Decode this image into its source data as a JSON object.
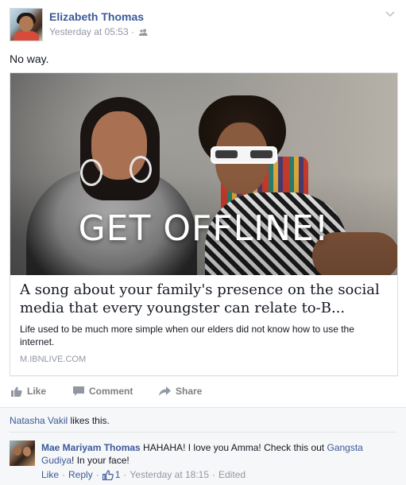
{
  "post": {
    "author": "Elizabeth Thomas",
    "timestamp": "Yesterday at 05:53",
    "audience_icon": "friends-icon",
    "message": "No way."
  },
  "share": {
    "image_caption": "GET OFFLINE!",
    "title": "A song about your family's presence on the social media that every youngster can relate to-B...",
    "description": "Life used to be much more simple when our elders did not know how to use the internet.",
    "domain": "M.IBNLIVE.COM"
  },
  "actions": {
    "like": "Like",
    "comment": "Comment",
    "share": "Share"
  },
  "likes": {
    "name": "Natasha Vakil",
    "suffix": " likes this."
  },
  "comment": {
    "author": "Mae Mariyam Thomas",
    "text_before": " HAHAHA! I love you Amma! Check this out ",
    "link": "Gangsta Gudiya",
    "text_after": "! In your face!",
    "like": "Like",
    "reply": "Reply",
    "like_count": "1",
    "timestamp": "Yesterday at 18:15",
    "edited": "Edited"
  },
  "colors": {
    "link": "#3b5998",
    "meta": "#9197a3",
    "ufi_bg": "#f6f7f8"
  }
}
